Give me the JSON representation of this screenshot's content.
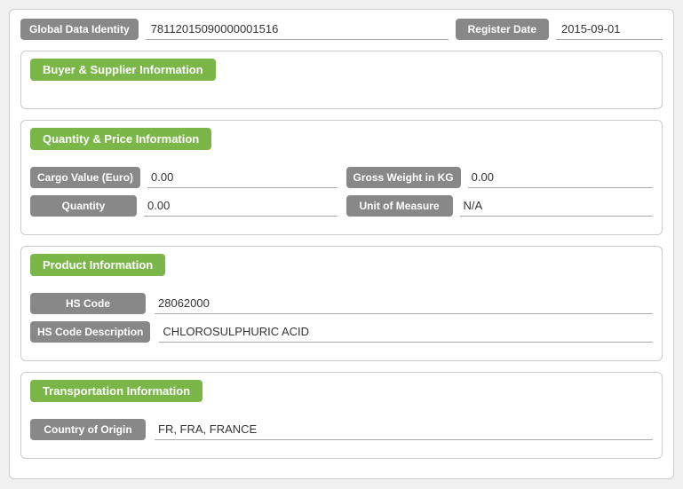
{
  "header": {
    "gdi_label": "Global Data Identity",
    "gdi_value": "78112015090000001516",
    "register_label": "Register Date",
    "register_value": "2015-09-01"
  },
  "sections": {
    "buyer_supplier": {
      "title": "Buyer & Supplier Information"
    },
    "quantity_price": {
      "title": "Quantity & Price Information",
      "fields": [
        {
          "label": "Cargo Value (Euro)",
          "value": "0.00",
          "right_label": "Gross Weight in KG",
          "right_value": "0.00"
        },
        {
          "label": "Quantity",
          "value": "0.00",
          "right_label": "Unit of Measure",
          "right_value": "N/A"
        }
      ]
    },
    "product": {
      "title": "Product Information",
      "fields": [
        {
          "label": "HS Code",
          "value": "28062000"
        },
        {
          "label": "HS Code Description",
          "value": "CHLOROSULPHURIC ACID"
        }
      ]
    },
    "transportation": {
      "title": "Transportation Information",
      "fields": [
        {
          "label": "Country of Origin",
          "value": "FR, FRA, FRANCE"
        }
      ]
    }
  }
}
